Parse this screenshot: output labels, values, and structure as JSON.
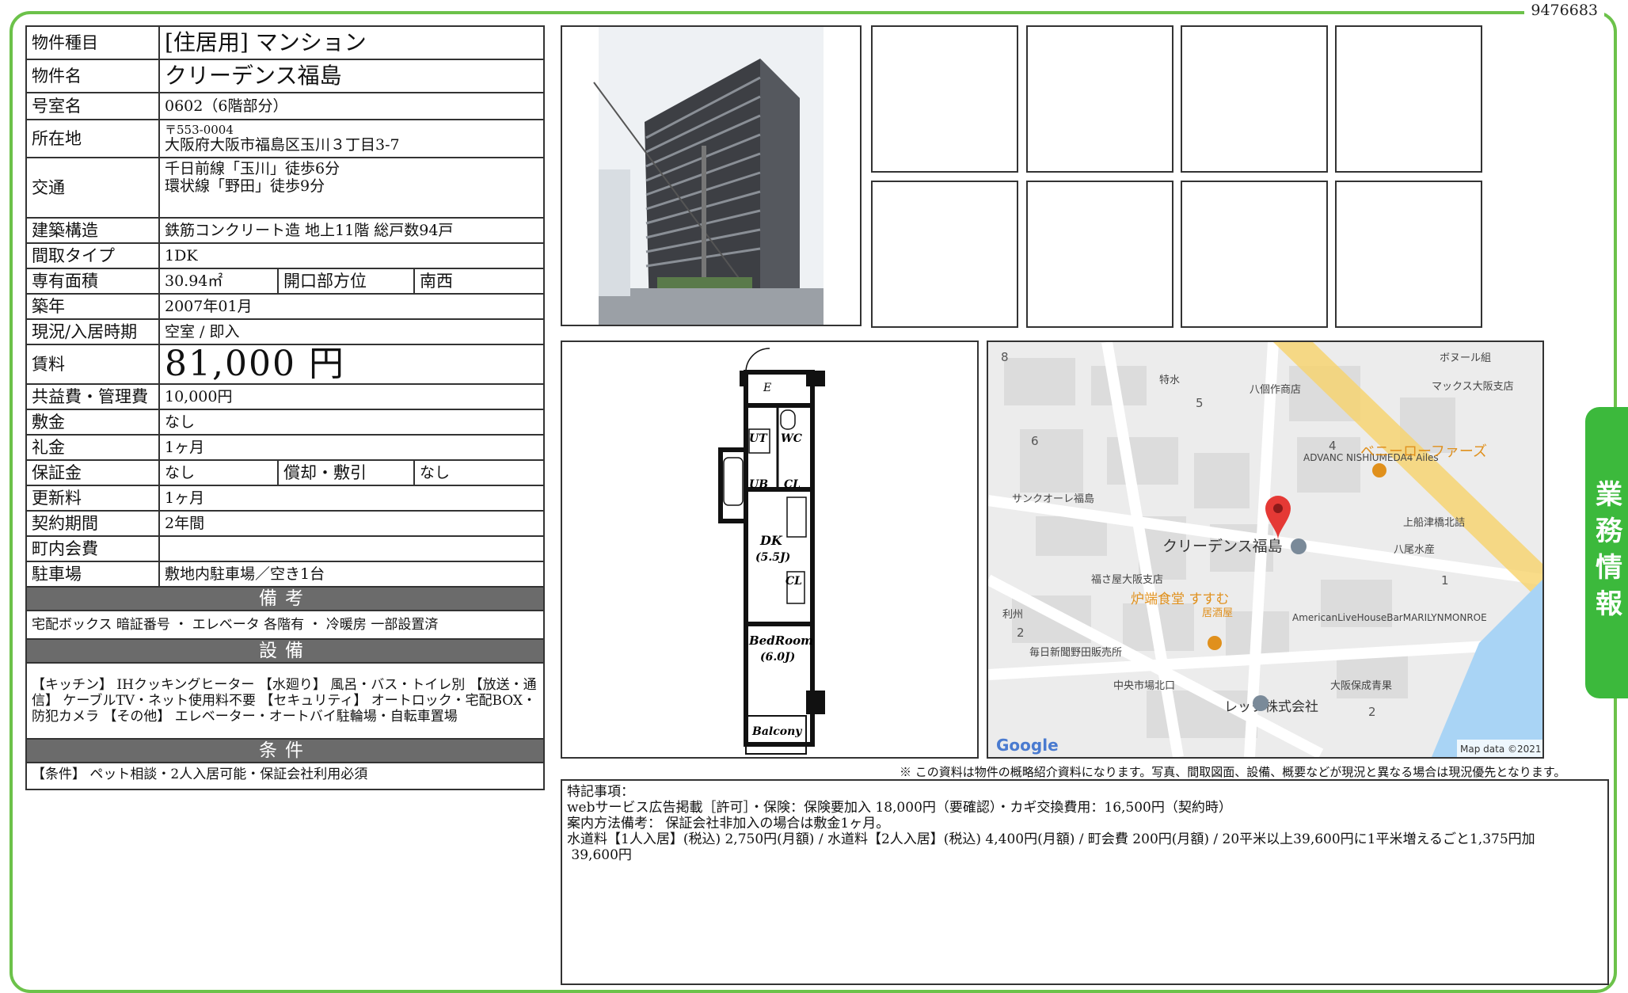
{
  "document_id": "9476683",
  "side_tab": "業務情報",
  "property": {
    "type_label": "物件種目",
    "type_value": "[住居用] マンション",
    "name_label": "物件名",
    "name_value": "クリーデンス福島",
    "room_label": "号室名",
    "room_value": "0602（6階部分）",
    "address_label": "所在地",
    "postal": "〒553-0004",
    "address": "大阪府大阪市福島区玉川３丁目3-7",
    "access_label": "交通",
    "access_line1": "千日前線「玉川」徒歩6分",
    "access_line2": "環状線「野田」徒歩9分",
    "structure_label": "建築構造",
    "structure_value": "鉄筋コンクリート造 地上11階 総戸数94戸",
    "layout_label": "間取タイプ",
    "layout_value": "1DK",
    "area_label": "専有面積",
    "area_value": "30.94㎡",
    "direction_label": "開口部方位",
    "direction_value": "南西",
    "built_label": "築年",
    "built_value": "2007年01月",
    "status_label": "現況/入居時期",
    "status_value": "空室 / 即入",
    "rent_label": "賃料",
    "rent_value": "81,000 円",
    "fee_label": "共益費・管理費",
    "fee_value": "10,000円",
    "deposit_label": "敷金",
    "deposit_value": "なし",
    "keymoney_label": "礼金",
    "keymoney_value": "1ヶ月",
    "guarantee_label": "保証金",
    "guarantee_value": "なし",
    "amort_label": "償却・敷引",
    "amort_value": "なし",
    "renewal_label": "更新料",
    "renewal_value": "1ヶ月",
    "contract_label": "契約期間",
    "contract_value": "2年間",
    "community_label": "町内会費",
    "community_value": "",
    "parking_label": "駐車場",
    "parking_value": "敷地内駐車場／空き1台"
  },
  "sections": {
    "biko_title": "備考",
    "biko_text": "宅配ボックス 暗証番号 ・ エレベータ 各階有 ・ 冷暖房 一部設置済",
    "setsubi_title": "設備",
    "setsubi_text": "【キッチン】 IHクッキングヒーター 【水廻り】 風呂・バス・トイレ別 【放送・通信】 ケーブルTV・ネット使用料不要 【セキュリティ】 オートロック・宅配BOX・防犯カメラ 【その他】 エレベーター・オートバイ駐輪場・自転車置場",
    "joken_title": "条件",
    "joken_text": "【条件】 ペット相談・2人入居可能・保証会社利用必須"
  },
  "floorplan": {
    "e": "E",
    "ut": "UT",
    "wc": "WC",
    "ub": "UB",
    "cl1": "CL",
    "dk": "DK",
    "dk_size": "(5.5J)",
    "cl2": "CL",
    "bed": "BedRoom",
    "bed_size": "(6.0J)",
    "balcony": "Balcony"
  },
  "map": {
    "labels": [
      "ボヌール組",
      "特水",
      "八個作商店",
      "マックス大阪支店",
      "ADVANC NISHIUMEDA4 Ailes",
      "ベニーローファーズ",
      "サンクオーレ福島",
      "上船津橋北詰",
      "クリーデンス福島",
      "八尾水産",
      "福さ屋大阪支店",
      "炉端食堂 すすむ",
      "居酒屋",
      "利州",
      "AmericanLiveHouseBarMARILYNMONROE",
      "毎日新聞野田販売所",
      "中央市場北口",
      "大阪保成青果",
      "レック株式会社"
    ],
    "numbers": [
      "8",
      "5",
      "6",
      "4",
      "1",
      "2",
      "2"
    ],
    "google": "Google",
    "attribution": "Map data ©2021"
  },
  "note": "※ この資料は物件の概略紹介資料になります。写真、間取図面、設備、概要などが現況と異なる場合は現況優先となります。",
  "remarks": {
    "title": "特記事項：",
    "line1": "webサービス広告掲載［許可］・保険：保険要加入 18,000円（要確認）・カギ交換費用：16,500円（契約時）",
    "line2": "案内方法備考： 保証会社非加入の場合は敷金1ヶ月。",
    "line3": "水道料【1人入居】(税込) 2,750円(月額) / 水道料【2人入居】(税込) 4,400円(月額) / 町会費 200円(月額) / 20平米以上39,600円に1平米増えるごと1,375円加",
    "line4": " 39,600円"
  }
}
